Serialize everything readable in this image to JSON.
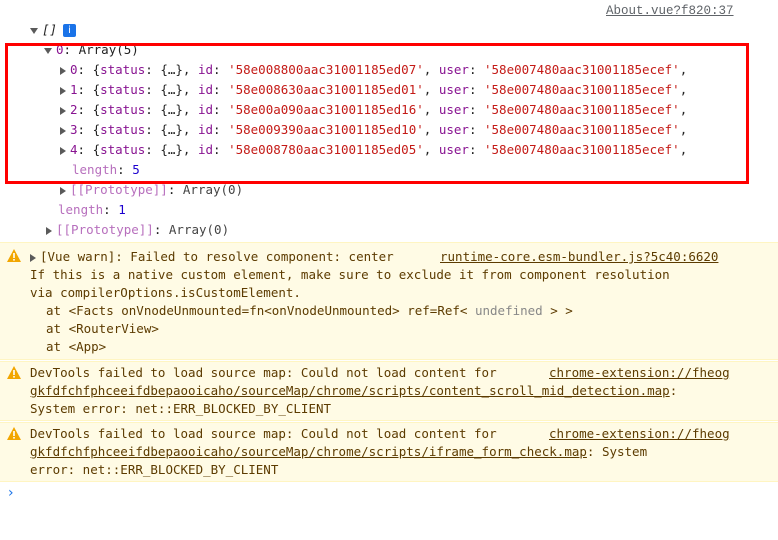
{
  "source_link": "About.vue?f820:37",
  "root": {
    "label": "[]",
    "info_icon": "i"
  },
  "array_item": {
    "key": "0",
    "value": "Array(5)"
  },
  "entries": [
    {
      "index": "1",
      "key": "0",
      "id": "58e008800aac31001185ed07",
      "user": "58e007480aac31001185ecef"
    },
    {
      "index": "2",
      "key": "1",
      "id": "58e008630aac31001185ed01",
      "user": "58e007480aac31001185ecef"
    },
    {
      "index": "3",
      "key": "2",
      "id": "58e00a090aac31001185ed16",
      "user": "58e007480aac31001185ecef"
    },
    {
      "index": "4",
      "key": "3",
      "id": "58e009390aac31001185ed10",
      "user": "58e007480aac31001185ecef"
    },
    {
      "index": "5",
      "key": "4",
      "id": "58e008780aac31001185ed05",
      "user": "58e007480aac31001185ecef"
    }
  ],
  "inner_length": {
    "key": "length",
    "value": "5"
  },
  "inner_proto": {
    "key": "[[Prototype]]",
    "value": "Array(0)"
  },
  "outer_length": {
    "key": "length",
    "value": "1"
  },
  "outer_proto": {
    "key": "[[Prototype]]",
    "value": "Array(0)"
  },
  "warnings": [
    {
      "line1_prefix": "[Vue warn]: Failed to resolve component: center",
      "line1_link": "runtime-core.esm-bundler.js?5c40:6620",
      "line2": "If this is a native custom element, make sure to exclude it from component resolution",
      "line3": "via compilerOptions.isCustomElement.",
      "line4_prefix": "at <Facts onVnodeUnmounted=fn<onVnodeUnmounted> ref=Ref<",
      "line4_undefined": "undefined",
      "line4_suffix": "> >",
      "line5": "at <RouterView>",
      "line6": "at <App>"
    },
    {
      "prefix": "DevTools failed to load source map: Could not load content for",
      "link_part1": "chrome-extension://fheog",
      "link_part2": "gkfdfchfphceeifdbepaooicaho/sourceMap/chrome/scripts/content_scroll_mid_detection.map",
      "after_link": ":",
      "line3": "System error: net::ERR_BLOCKED_BY_CLIENT"
    },
    {
      "prefix": "DevTools failed to load source map: Could not load content for",
      "link_part1": "chrome-extension://fheog",
      "link_part2": "gkfdfchfphceeifdbepaooicaho/sourceMap/chrome/scripts/iframe_form_check.map",
      "after_link": ": System",
      "line3": "error: net::ERR_BLOCKED_BY_CLIENT"
    }
  ],
  "prompt_symbol": "›"
}
